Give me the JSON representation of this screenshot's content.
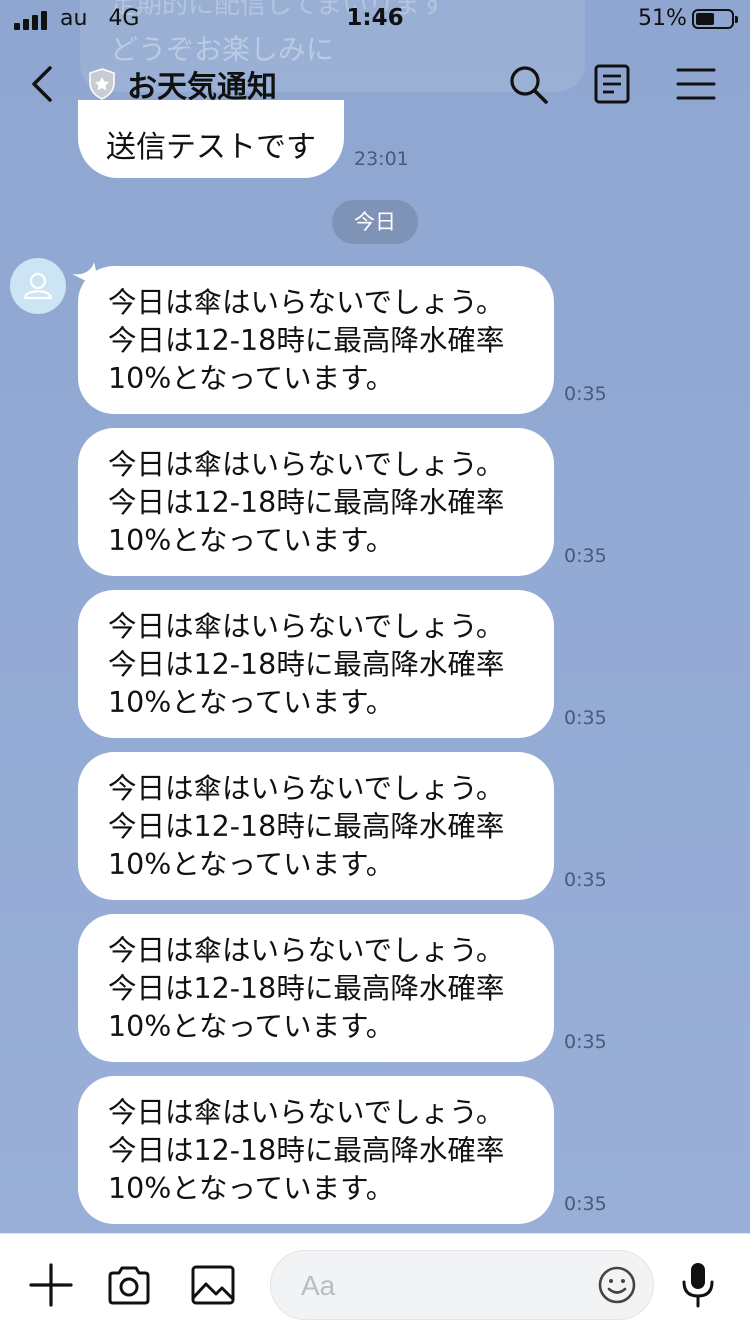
{
  "status_bar": {
    "carrier": "au",
    "network": "4G",
    "time": "1:46",
    "battery_percent": "51%",
    "battery_level": 0.51
  },
  "header": {
    "title": "お天気通知",
    "icons": [
      "back-chevron-icon",
      "official-shield-icon",
      "search-icon",
      "notes-icon",
      "menu-icon"
    ]
  },
  "background_pinned": {
    "line1": "定期的に配信してまいります",
    "line2": "どうぞお楽しみに"
  },
  "messages": [
    {
      "sender": "self",
      "text": "送信テストです",
      "time": "23:01"
    }
  ],
  "date_divider": "今日",
  "bot_messages": [
    {
      "lines": [
        "今日は傘はいらないでしょう。",
        "今日は12-18時に最高降水確率",
        "10%となっています。"
      ],
      "time": "0:35"
    },
    {
      "lines": [
        "今日は傘はいらないでしょう。",
        "今日は12-18時に最高降水確率",
        "10%となっています。"
      ],
      "time": "0:35"
    },
    {
      "lines": [
        "今日は傘はいらないでしょう。",
        "今日は12-18時に最高降水確率",
        "10%となっています。"
      ],
      "time": "0:35"
    },
    {
      "lines": [
        "今日は傘はいらないでしょう。",
        "今日は12-18時に最高降水確率",
        "10%となっています。"
      ],
      "time": "0:35"
    },
    {
      "lines": [
        "今日は傘はいらないでしょう。",
        "今日は12-18時に最高降水確率",
        "10%となっています。"
      ],
      "time": "0:35"
    },
    {
      "lines": [
        "今日は傘はいらないでしょう。",
        "今日は12-18時に最高降水確率",
        "10%となっています。"
      ],
      "time": "0:35"
    }
  ],
  "input_bar": {
    "placeholder": "Aa",
    "icons": [
      "plus-icon",
      "camera-icon",
      "image-icon",
      "emoji-icon",
      "microphone-icon"
    ]
  },
  "colors": {
    "background": "#93aad4",
    "bubble": "#ffffff",
    "date_pill": "#7f93b6",
    "timestamp": "#4b5a75",
    "avatar": "#cde4f4"
  }
}
